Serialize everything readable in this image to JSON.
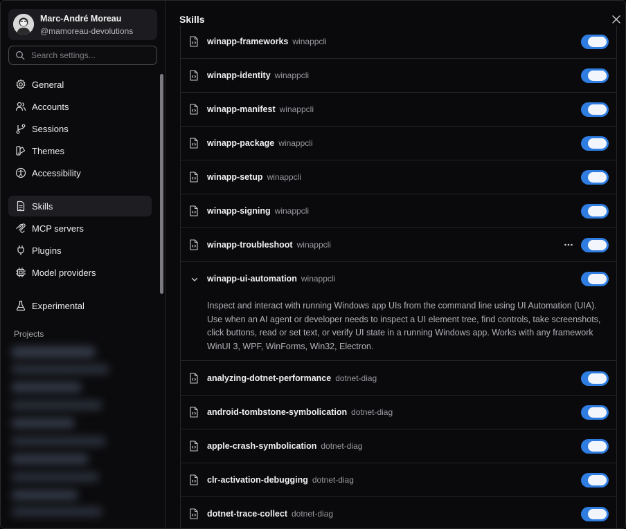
{
  "profile": {
    "name": "Marc-André Moreau",
    "handle": "@mamoreau-devolutions"
  },
  "search": {
    "placeholder": "Search settings..."
  },
  "nav": {
    "items": [
      {
        "label": "General",
        "icon": "gear-icon"
      },
      {
        "label": "Accounts",
        "icon": "users-icon"
      },
      {
        "label": "Sessions",
        "icon": "branch-icon"
      },
      {
        "label": "Themes",
        "icon": "palette-icon"
      },
      {
        "label": "Accessibility",
        "icon": "accessibility-icon"
      },
      {
        "label": "Skills",
        "icon": "document-icon",
        "active": true
      },
      {
        "label": "MCP servers",
        "icon": "mcp-icon"
      },
      {
        "label": "Plugins",
        "icon": "plug-icon"
      },
      {
        "label": "Model providers",
        "icon": "chip-icon"
      },
      {
        "label": "Experimental",
        "icon": "flask-icon"
      }
    ],
    "projects_label": "Projects"
  },
  "main": {
    "title": "Skills",
    "skills": [
      {
        "name": "winapp-frameworks",
        "source": "winappcli",
        "enabled": true
      },
      {
        "name": "winapp-identity",
        "source": "winappcli",
        "enabled": true
      },
      {
        "name": "winapp-manifest",
        "source": "winappcli",
        "enabled": true
      },
      {
        "name": "winapp-package",
        "source": "winappcli",
        "enabled": true
      },
      {
        "name": "winapp-setup",
        "source": "winappcli",
        "enabled": true
      },
      {
        "name": "winapp-signing",
        "source": "winappcli",
        "enabled": true
      },
      {
        "name": "winapp-troubleshoot",
        "source": "winappcli",
        "enabled": true
      },
      {
        "name": "winapp-ui-automation",
        "source": "winappcli",
        "enabled": true,
        "expanded": true,
        "description": "Inspect and interact with running Windows app UIs from the command line using UI Automation (UIA). Use when an AI agent or developer needs to inspect a UI element tree, find controls, take screenshots, click buttons, read or set text, or verify UI state in a running Windows app. Works with any framework WinUI 3, WPF, WinForms, Win32, Electron."
      },
      {
        "name": "analyzing-dotnet-performance",
        "source": "dotnet-diag",
        "enabled": true
      },
      {
        "name": "android-tombstone-symbolication",
        "source": "dotnet-diag",
        "enabled": true
      },
      {
        "name": "apple-crash-symbolication",
        "source": "dotnet-diag",
        "enabled": true
      },
      {
        "name": "clr-activation-debugging",
        "source": "dotnet-diag",
        "enabled": true
      },
      {
        "name": "dotnet-trace-collect",
        "source": "dotnet-diag",
        "enabled": true
      }
    ]
  },
  "colors": {
    "accent": "#2f7de1",
    "background": "#0a0a0c"
  }
}
